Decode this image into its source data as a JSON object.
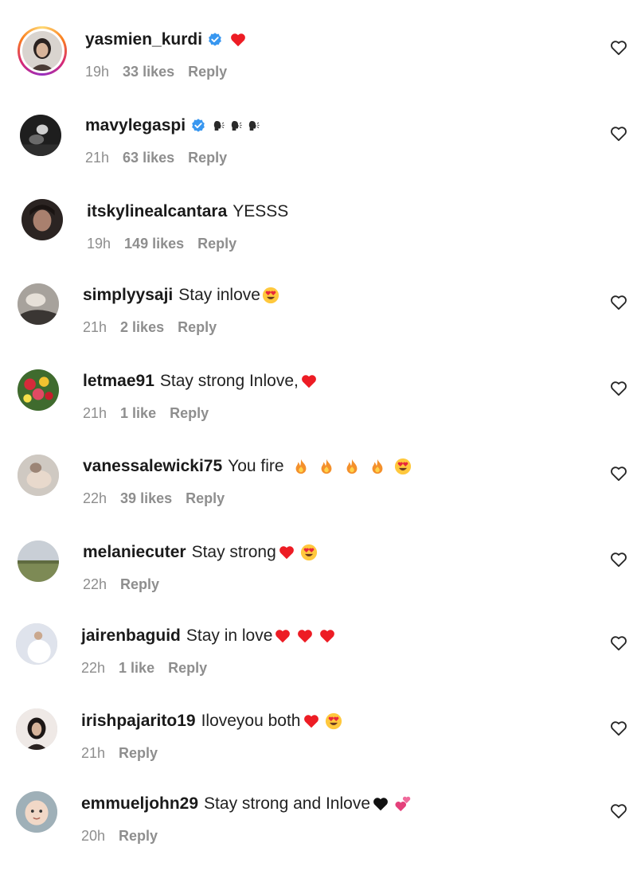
{
  "comments": [
    {
      "username": "yasmien_kurdi",
      "verified": true,
      "text": "",
      "emojis": [
        "heart"
      ],
      "time": "19h",
      "likes": "33 likes",
      "reply": "Reply"
    },
    {
      "username": "mavylegaspi",
      "verified": true,
      "text": "",
      "emojis": [
        "speaking-head",
        "speaking-head",
        "speaking-head"
      ],
      "time": "21h",
      "likes": "63 likes",
      "reply": "Reply"
    },
    {
      "username": "itskylinealcantara",
      "verified": false,
      "text": "YESSS",
      "emojis": [],
      "time": "19h",
      "likes": "149 likes",
      "reply": "Reply"
    },
    {
      "username": "simplyysaji",
      "verified": false,
      "text": "Stay inlove",
      "emojis": [
        "heart-eyes"
      ],
      "time": "21h",
      "likes": "2 likes",
      "reply": "Reply"
    },
    {
      "username": "letmae91",
      "verified": false,
      "text": "Stay strong Inlove,",
      "emojis": [
        "heart"
      ],
      "time": "21h",
      "likes": "1 like",
      "reply": "Reply"
    },
    {
      "username": "vanessalewicki75",
      "verified": false,
      "text": "You fire",
      "emojis": [
        "fire",
        "fire",
        "fire",
        "fire",
        "heart-eyes"
      ],
      "time": "22h",
      "likes": "39 likes",
      "reply": "Reply"
    },
    {
      "username": "melaniecuter",
      "verified": false,
      "text": "Stay strong",
      "emojis": [
        "heart",
        "heart-eyes"
      ],
      "time": "22h",
      "likes": "",
      "reply": "Reply"
    },
    {
      "username": "jairenbaguid",
      "verified": false,
      "text": "Stay in love",
      "emojis": [
        "heart",
        "heart",
        "heart"
      ],
      "time": "22h",
      "likes": "1 like",
      "reply": "Reply"
    },
    {
      "username": "irishpajarito19",
      "verified": false,
      "text": "Iloveyou both",
      "emojis": [
        "heart",
        "heart-eyes"
      ],
      "time": "21h",
      "likes": "",
      "reply": "Reply"
    },
    {
      "username": "emmueljohn29",
      "verified": false,
      "text": "Stay strong and Inlove",
      "emojis": [
        "black-heart",
        "two-hearts"
      ],
      "time": "20h",
      "likes": "",
      "reply": "Reply"
    }
  ],
  "colors": {
    "username": "#1a1a1a",
    "meta": "#8e8e8e",
    "verified": "#3897f0",
    "heart": "#ed1c24"
  }
}
